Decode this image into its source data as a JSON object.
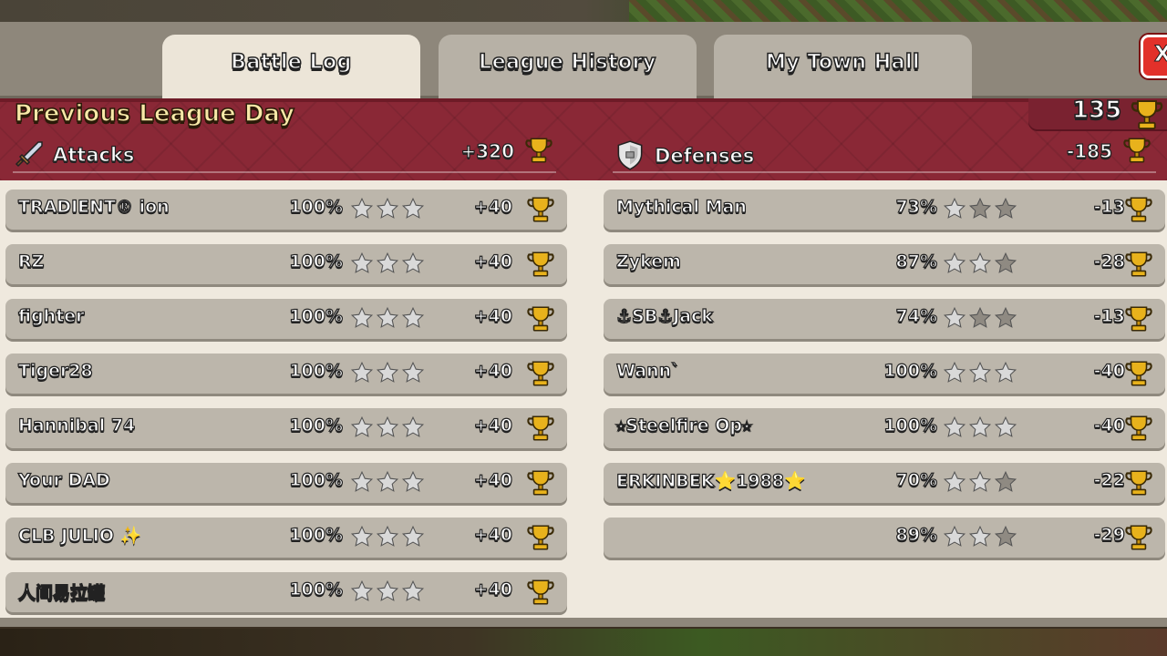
{
  "tabs": [
    {
      "label": "Battle Log",
      "active": true
    },
    {
      "label": "League History",
      "active": false
    },
    {
      "label": "My Town Hall",
      "active": false
    }
  ],
  "close_label": "X",
  "banner": {
    "title": "Previous League Day",
    "trophies": "135"
  },
  "attacks": {
    "label": "Attacks",
    "total": "+320",
    "rows": [
      {
        "name": "TRADIENT® ion",
        "pct": "100%",
        "stars": 3,
        "trophies": "+40"
      },
      {
        "name": "RZ",
        "pct": "100%",
        "stars": 3,
        "trophies": "+40"
      },
      {
        "name": "fighter",
        "pct": "100%",
        "stars": 3,
        "trophies": "+40"
      },
      {
        "name": "Tiger28",
        "pct": "100%",
        "stars": 3,
        "trophies": "+40"
      },
      {
        "name": "Hannibal 74",
        "pct": "100%",
        "stars": 3,
        "trophies": "+40"
      },
      {
        "name": "Your DAD",
        "pct": "100%",
        "stars": 3,
        "trophies": "+40"
      },
      {
        "name": "CLB JULIO ✨",
        "pct": "100%",
        "stars": 3,
        "trophies": "+40"
      },
      {
        "name": "人间易拉罐",
        "pct": "100%",
        "stars": 3,
        "trophies": "+40"
      }
    ]
  },
  "defenses": {
    "label": "Defenses",
    "total": "-185",
    "rows": [
      {
        "name": "Mythical Man",
        "pct": "73%",
        "stars": 1,
        "trophies": "-13"
      },
      {
        "name": "Zykem",
        "pct": "87%",
        "stars": 2,
        "trophies": "-28"
      },
      {
        "name": "⚓SB⚓Jack",
        "pct": "74%",
        "stars": 1,
        "trophies": "-13"
      },
      {
        "name": "Wann`",
        "pct": "100%",
        "stars": 3,
        "trophies": "-40"
      },
      {
        "name": "⭑Steelfire Op⭑",
        "pct": "100%",
        "stars": 3,
        "trophies": "-40"
      },
      {
        "name": "ERKINBEK⭐1988⭐",
        "pct": "70%",
        "stars": 2,
        "trophies": "-22"
      },
      {
        "name": "",
        "pct": "89%",
        "stars": 2,
        "trophies": "-29"
      }
    ]
  },
  "colors": {
    "banner": "#8a2836",
    "row": "#bcb6ab",
    "panel": "#efe9de",
    "star_earned": "#d9d9d9",
    "star_missing": "#8f8a82",
    "trophy": "#e8b21c"
  },
  "icons": {
    "attack": "sword-icon",
    "defense": "shield-icon",
    "trophy": "trophy-icon",
    "star": "star-icon",
    "close": "close-icon"
  }
}
